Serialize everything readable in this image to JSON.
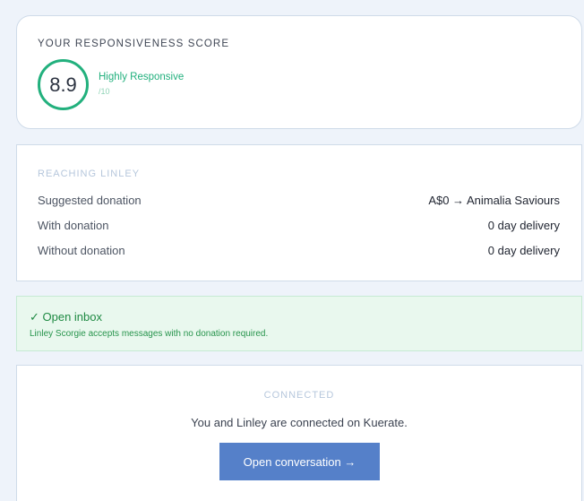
{
  "score": {
    "title": "YOUR RESPONSIVENESS SCORE",
    "value": "8.9",
    "label": "Highly Responsive",
    "out_of": "/10"
  },
  "reaching": {
    "title": "REACHING LINLEY",
    "rows": [
      {
        "label": "Suggested donation",
        "value": "A$0 → Animalia Saviours"
      },
      {
        "label": "With donation",
        "value": "0 day delivery"
      },
      {
        "label": "Without donation",
        "value": "0 day delivery"
      }
    ]
  },
  "inbox": {
    "title": "✓ Open inbox",
    "description": "Linley Scorgie accepts messages with no donation required."
  },
  "connected": {
    "title": "CONNECTED",
    "text": "You and Linley are connected on Kuerate.",
    "button_label": "Open conversation →"
  },
  "colors": {
    "accent_green": "#22b07d",
    "button_blue": "#5580c9",
    "inbox_bg": "#e9f8ee"
  }
}
